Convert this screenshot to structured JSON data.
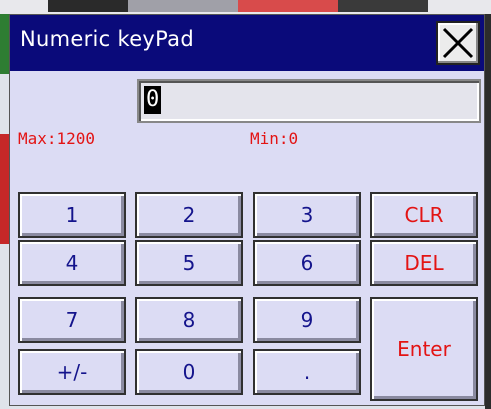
{
  "dialog": {
    "title": "Numeric keyPad",
    "close_icon": "close-icon"
  },
  "display": {
    "value": "0"
  },
  "limits": {
    "max_label": "Max:1200",
    "min_label": "Min:0"
  },
  "keys": {
    "k1": "1",
    "k2": "2",
    "k3": "3",
    "clr": "CLR",
    "k4": "4",
    "k5": "5",
    "k6": "6",
    "del": "DEL",
    "k7": "7",
    "k8": "8",
    "k9": "9",
    "enter": "Enter",
    "sign": "+/-",
    "k0": "0",
    "dot": "."
  },
  "colors": {
    "titlebar": "#0a0a7a",
    "dialog_bg": "#dcdcf4",
    "digit_text": "#14148c",
    "action_text": "#e31414",
    "limit_text": "#e31414"
  }
}
